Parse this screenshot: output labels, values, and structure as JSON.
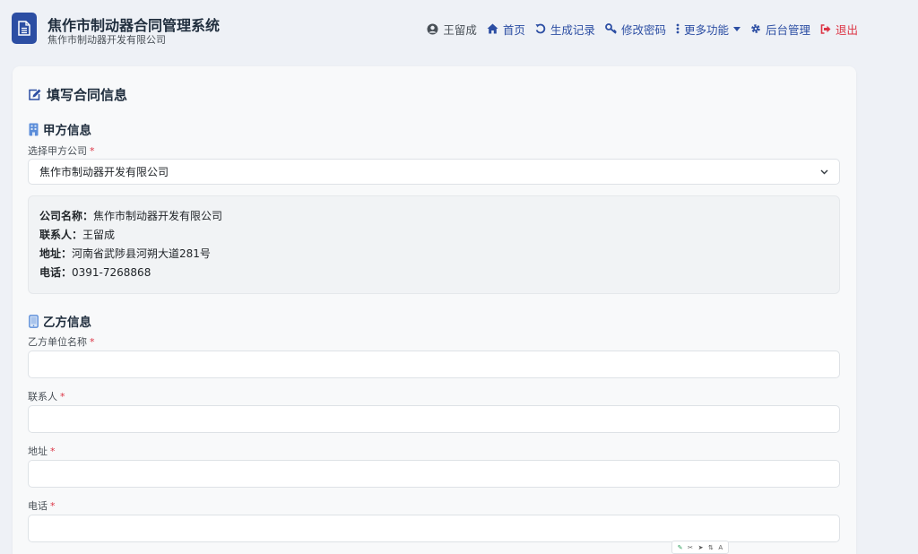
{
  "app": {
    "title": "焦作市制动器合同管理系统",
    "subtitle": "焦作市制动器开发有限公司"
  },
  "nav": {
    "user": "王留成",
    "home": "首页",
    "history": "生成记录",
    "change_password": "修改密码",
    "more": "更多功能",
    "admin": "后台管理",
    "logout": "退出"
  },
  "form": {
    "title": "填写合同信息",
    "party_a": {
      "section_title": "甲方信息",
      "select_label": "选择甲方公司",
      "selected_company": "焦作市制动器开发有限公司",
      "details": [
        {
          "label": "公司名称：",
          "value": "焦作市制动器开发有限公司"
        },
        {
          "label": "联系人：",
          "value": "王留成"
        },
        {
          "label": "地址：",
          "value": "河南省武陟县河朔大道281号"
        },
        {
          "label": "电话：",
          "value": "0391-7268868"
        }
      ]
    },
    "party_b": {
      "section_title": "乙方信息",
      "fields": [
        {
          "label": "乙方单位名称",
          "value": ""
        },
        {
          "label": "联系人",
          "value": ""
        },
        {
          "label": "地址",
          "value": ""
        },
        {
          "label": "电话",
          "value": ""
        }
      ]
    },
    "required_mark": "*"
  },
  "toolbar": {
    "items": [
      "✎",
      "✂",
      "➤",
      "⇅",
      "A"
    ]
  },
  "colors": {
    "brand": "#2c4ea3",
    "danger": "#dc3545",
    "background": "#eef1f6"
  }
}
